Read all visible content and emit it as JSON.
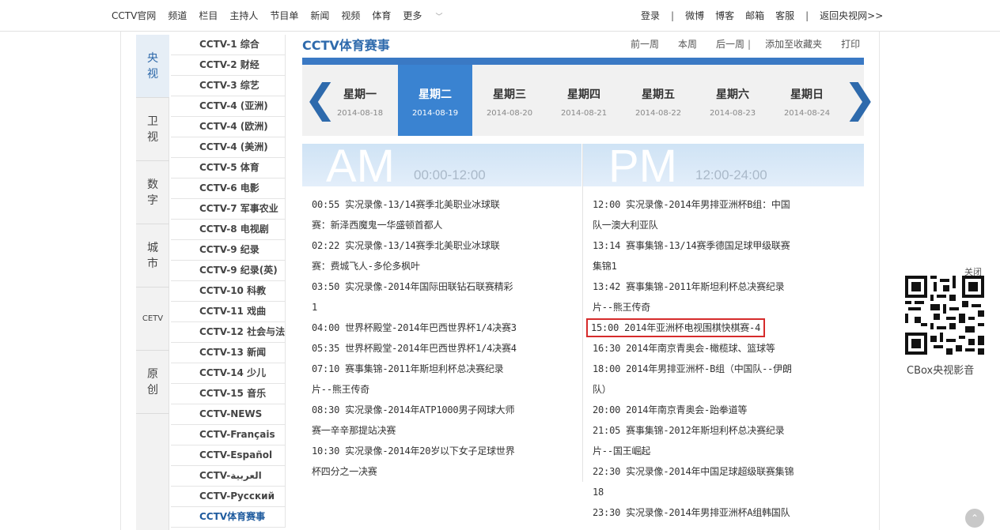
{
  "topnav": {
    "left": [
      "CCTV官网",
      "频道",
      "栏目",
      "主持人",
      "节目单",
      "新闻",
      "视频",
      "体育",
      "更多"
    ],
    "right": [
      "登录",
      "微博",
      "博客",
      "邮箱",
      "客服",
      "返回央视网>>"
    ]
  },
  "categories": [
    "央视",
    "卫视",
    "数字",
    "城市",
    "CETV",
    "原创"
  ],
  "channels": [
    "CCTV-1 综合",
    "CCTV-2 财经",
    "CCTV-3 综艺",
    "CCTV-4 (亚洲)",
    "CCTV-4 (欧洲)",
    "CCTV-4 (美洲)",
    "CCTV-5 体育",
    "CCTV-6 电影",
    "CCTV-7 军事农业",
    "CCTV-8 电视剧",
    "CCTV-9 纪录",
    "CCTV-9 纪录(英)",
    "CCTV-10 科教",
    "CCTV-11 戏曲",
    "CCTV-12 社会与法",
    "CCTV-13 新闻",
    "CCTV-14 少儿",
    "CCTV-15 音乐",
    "CCTV-NEWS",
    "CCTV-Français",
    "CCTV-Español",
    "CCTV-العربية",
    "CCTV-Русский",
    "CCTV体育赛事"
  ],
  "page_title": "CCTV体育赛事",
  "tools": {
    "prev_week": "前一周",
    "this_week": "本周",
    "next_week": "后一周",
    "favorite": "添加至收藏夹",
    "print": "打印"
  },
  "days": [
    {
      "name": "星期一",
      "date": "2014-08-18"
    },
    {
      "name": "星期二",
      "date": "2014-08-19"
    },
    {
      "name": "星期三",
      "date": "2014-08-20"
    },
    {
      "name": "星期四",
      "date": "2014-08-21"
    },
    {
      "name": "星期五",
      "date": "2014-08-22"
    },
    {
      "name": "星期六",
      "date": "2014-08-23"
    },
    {
      "name": "星期日",
      "date": "2014-08-24"
    }
  ],
  "am": {
    "label": "AM",
    "range": "00:00-12:00"
  },
  "pm": {
    "label": "PM",
    "range": "12:00-24:00"
  },
  "am_lines": [
    "00:55 实况录像-13/14赛季北美职业冰球联",
    "赛：新泽西魔鬼一华盛顿首都人",
    "02:22 实况录像-13/14赛季北美职业冰球联",
    "赛：费城飞人-多伦多枫叶",
    "03:50 实况录像-2014年国际田联钻石联赛精彩",
    "1",
    "04:00 世界杯殿堂-2014年巴西世界杯1/4决赛3",
    "05:35 世界杯殿堂-2014年巴西世界杯1/4决赛4",
    "07:10 赛事集锦-2011年斯坦利杯总决赛纪录",
    "片--熊王传奇",
    "08:30 实况录像-2014年ATP1000男子网球大师",
    "赛一辛辛那提站决赛",
    "10:30 实况录像-2014年20岁以下女子足球世界",
    "杯四分之一决赛"
  ],
  "pm_lines": [
    "12:00 实况录像-2014年男排亚洲杯B组：中国",
    "队一澳大利亚队",
    "13:14 赛事集锦-13/14赛季德国足球甲级联赛",
    "集锦1",
    "13:42 赛事集锦-2011年斯坦利杯总决赛纪录",
    "片--熊王传奇",
    "15:00 2014年亚洲杯电视围棋快棋赛-4",
    "16:30 2014年南京青奥会-橄榄球、篮球等",
    "18:00 2014年男排亚洲杯-B组（中国队--伊朗",
    "队）",
    "20:00 2014年南京青奥会-跆拳道等",
    "21:05 赛事集锦-2012年斯坦利杯总决赛纪录",
    "片--国王崛起",
    "22:30 实况录像-2014年中国足球超级联赛集锦",
    "18",
    "23:30 实况录像-2014年男排亚洲杯A组韩国队"
  ],
  "highlighted_pm_index": 6,
  "qr": {
    "close": "关闭",
    "label": "CBox央视影音"
  },
  "colors": {
    "accent": "#3a79c4",
    "selected_day": "#3a83d1",
    "highlight": "#d62b2b"
  }
}
